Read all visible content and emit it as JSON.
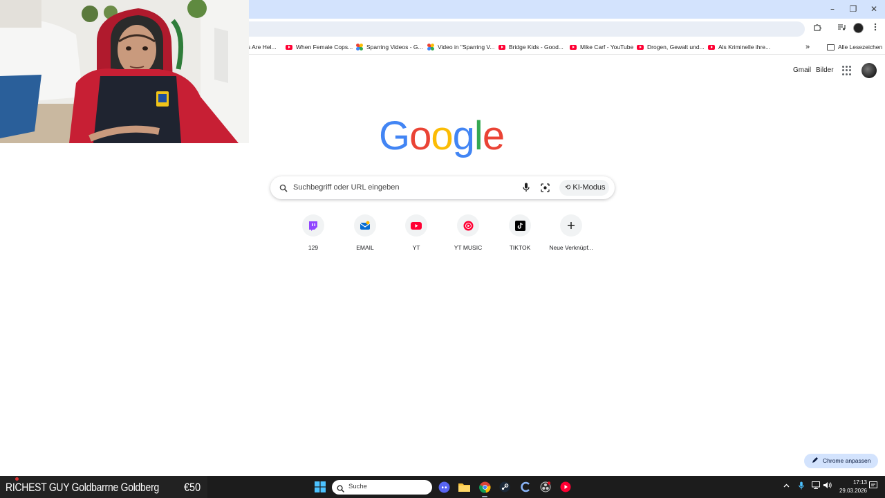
{
  "window": {
    "minimize_glyph": "–",
    "restore_glyph": "❐",
    "close_glyph": "✕"
  },
  "bookmarks": {
    "items": [
      {
        "label": "s Are Hel...",
        "icon": "none"
      },
      {
        "label": "When Female Cops...",
        "icon": "youtube-icon"
      },
      {
        "label": "Sparring Videos - G...",
        "icon": "google-photos-icon"
      },
      {
        "label": "Video in \"Sparring V...",
        "icon": "google-photos-icon"
      },
      {
        "label": "Bridge Kids - Good...",
        "icon": "youtube-icon"
      },
      {
        "label": "Mike Carf - YouTube",
        "icon": "youtube-icon"
      },
      {
        "label": "Drogen, Gewalt und...",
        "icon": "youtube-icon"
      },
      {
        "label": "Als Kriminelle ihre...",
        "icon": "youtube-icon"
      }
    ],
    "overflow_glyph": "»",
    "all_bookmarks_label": "Alle Lesezeichen"
  },
  "google": {
    "header_links": {
      "gmail": "Gmail",
      "images": "Bilder"
    },
    "logo_letters": [
      {
        "char": "G",
        "color": "#4285f4"
      },
      {
        "char": "o",
        "color": "#ea4335"
      },
      {
        "char": "o",
        "color": "#fbbc05"
      },
      {
        "char": "g",
        "color": "#4285f4"
      },
      {
        "char": "l",
        "color": "#34a853"
      },
      {
        "char": "e",
        "color": "#ea4335"
      }
    ],
    "search": {
      "placeholder": "Suchbegriff oder URL eingeben",
      "ai_mode_label": "KI-Modus"
    },
    "shortcuts": [
      {
        "label": "129",
        "icon": "twitch-icon"
      },
      {
        "label": "EMAIL",
        "icon": "email-icon"
      },
      {
        "label": "YT",
        "icon": "youtube-icon"
      },
      {
        "label": "YT MUSIC",
        "icon": "youtube-music-icon"
      },
      {
        "label": "TIKTOK",
        "icon": "tiktok-icon"
      },
      {
        "label": "Neue Verknüpf...",
        "icon": "plus-icon"
      }
    ],
    "customize_label": "Chrome anpassen"
  },
  "overlay": {
    "title": "RICHEST GUY Goldbarrne Goldberg",
    "amount": "€50"
  },
  "taskbar": {
    "search_label": "Suche",
    "time": "17:13",
    "date": "29.03.2026"
  },
  "colors": {
    "tabstrip": "#d3e3fd",
    "accent": "#0b57d0",
    "taskbar": "#1c1c1c"
  }
}
